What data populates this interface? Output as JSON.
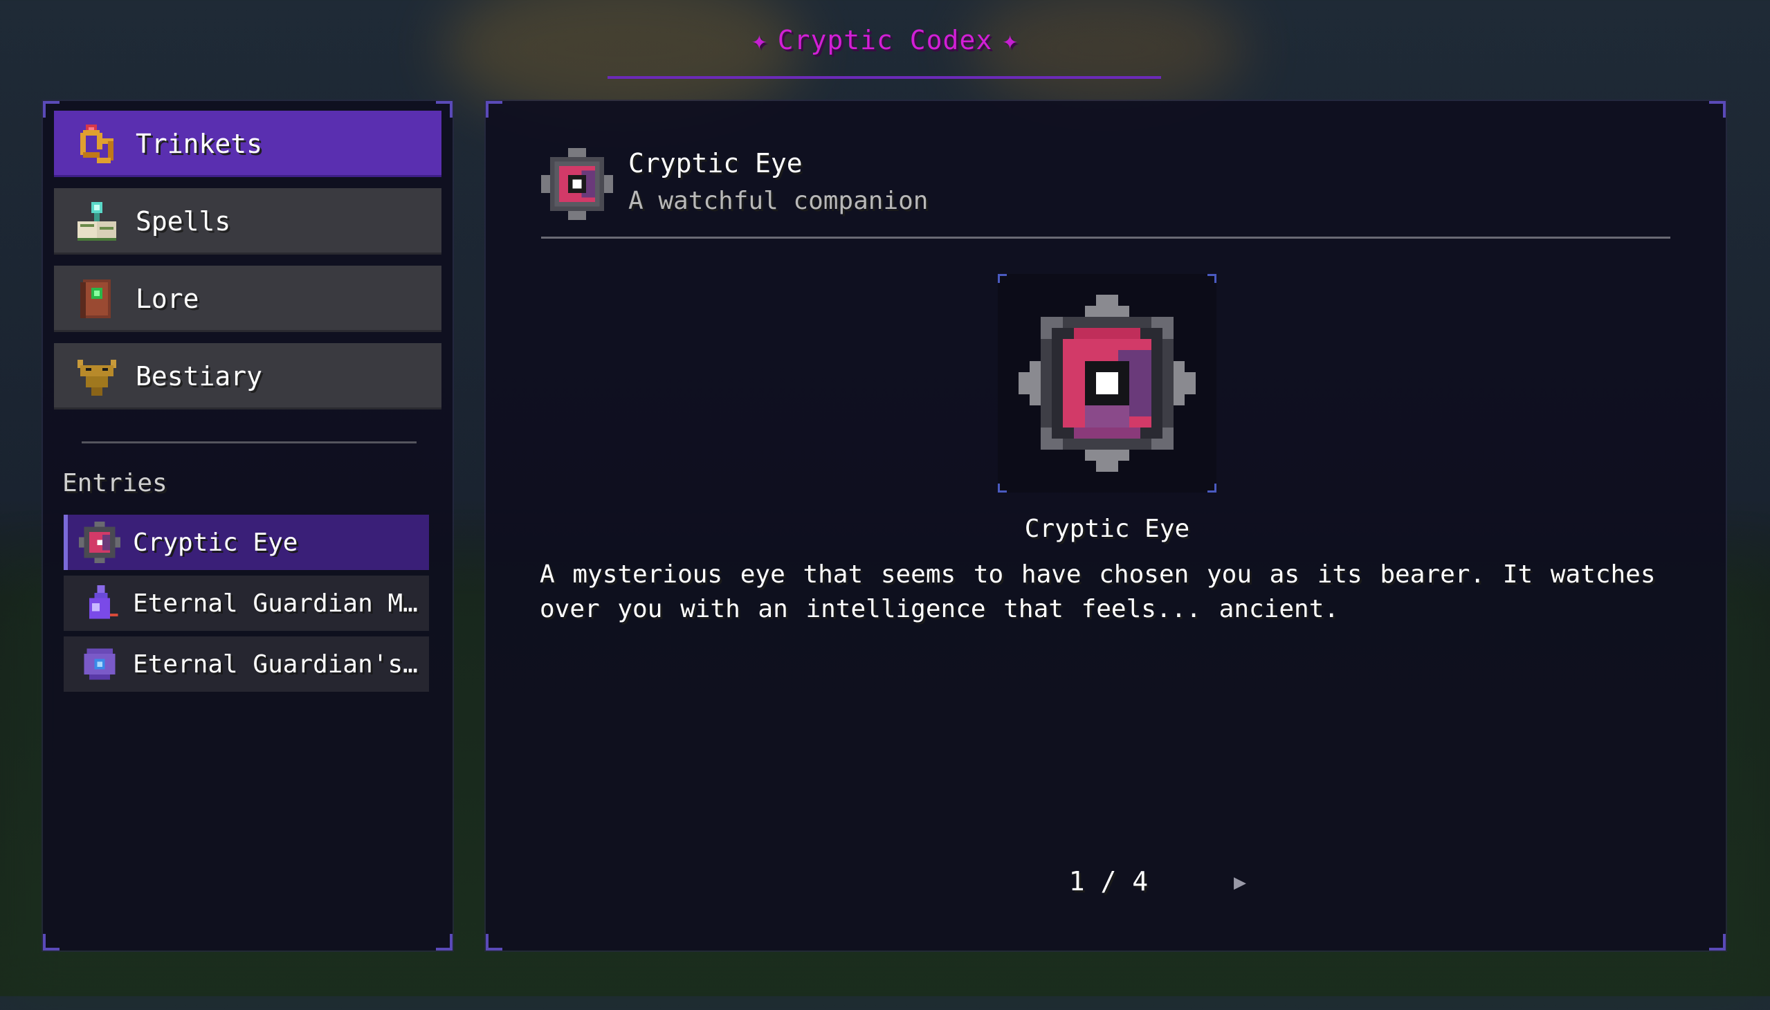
{
  "header": {
    "title": "Cryptic Codex",
    "star_left": "✦",
    "star_right": "✦"
  },
  "categories": [
    {
      "label": "Trinkets",
      "icon": "ring-icon",
      "active": true
    },
    {
      "label": "Spells",
      "icon": "spellbook-icon",
      "active": false
    },
    {
      "label": "Lore",
      "icon": "lore-book-icon",
      "active": false
    },
    {
      "label": "Bestiary",
      "icon": "dragon-head-icon",
      "active": false
    }
  ],
  "entries_heading": "Entries",
  "entries": [
    {
      "label": "Cryptic Eye",
      "icon": "cryptic-eye-icon",
      "active": true
    },
    {
      "label": "Eternal Guardian M...",
      "icon": "guardian-potion-icon",
      "active": false
    },
    {
      "label": "Eternal Guardian's...",
      "icon": "guardian-amulet-icon",
      "active": false
    }
  ],
  "detail": {
    "title": "Cryptic Eye",
    "subtitle": "A watchful companion",
    "preview_caption": "Cryptic Eye",
    "description": "A mysterious eye that seems to have chosen you as its bearer. It watches over you with an intelligence that feels... ancient.",
    "page": "1 / 4",
    "next_glyph": "▶"
  },
  "colors": {
    "title": "#d21fd6",
    "active_category": "#5a2fb0",
    "active_entry": "#3a1f78",
    "panel": "#0e0e1e",
    "accent_line": "#6b2ab8"
  }
}
